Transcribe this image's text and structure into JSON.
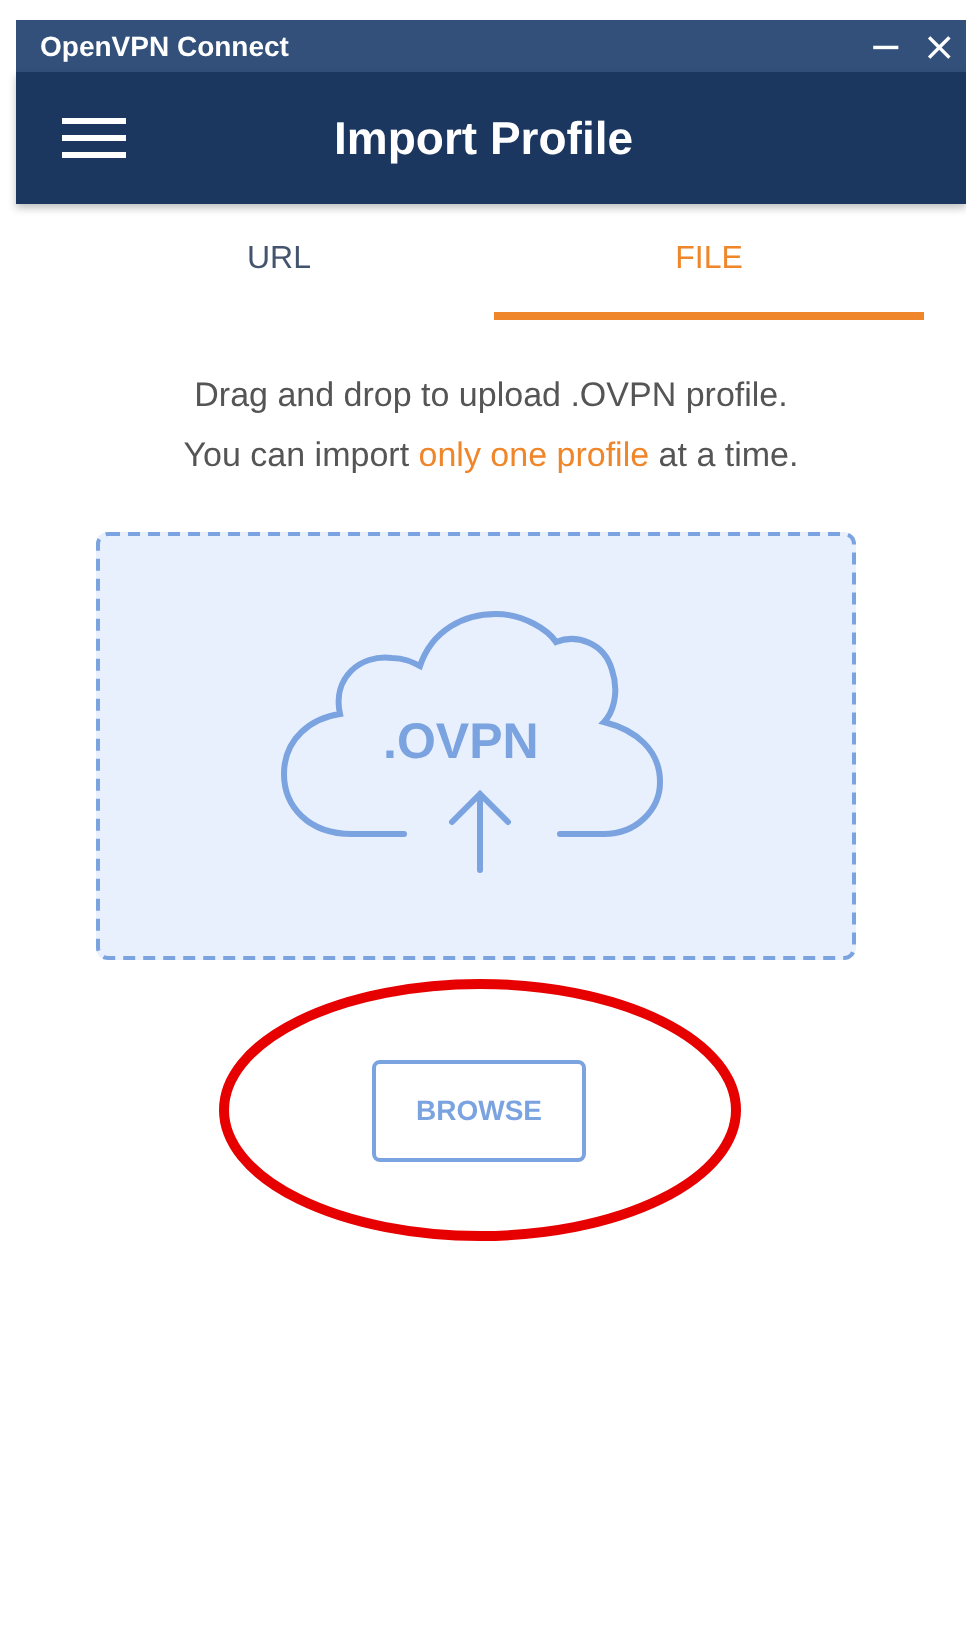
{
  "window": {
    "title": "OpenVPN Connect",
    "controls": [
      "−",
      "×"
    ]
  },
  "header": {
    "title": "Import Profile"
  },
  "tabs": [
    {
      "label": "URL",
      "selected": false
    },
    {
      "label": "FILE",
      "selected": true
    }
  ],
  "instructions": [
    [
      {
        "text": "Drag and drop to upload .OVPN profile.",
        "highlight": false
      }
    ],
    [
      {
        "text": "You can import ",
        "highlight": false
      },
      {
        "text": "only one profile",
        "highlight": true
      },
      {
        "text": " at a time.",
        "highlight": false
      }
    ]
  ],
  "drop_zone": {
    "label": ".OVPN"
  },
  "browse_button": {
    "label": "BROWSE"
  }
}
